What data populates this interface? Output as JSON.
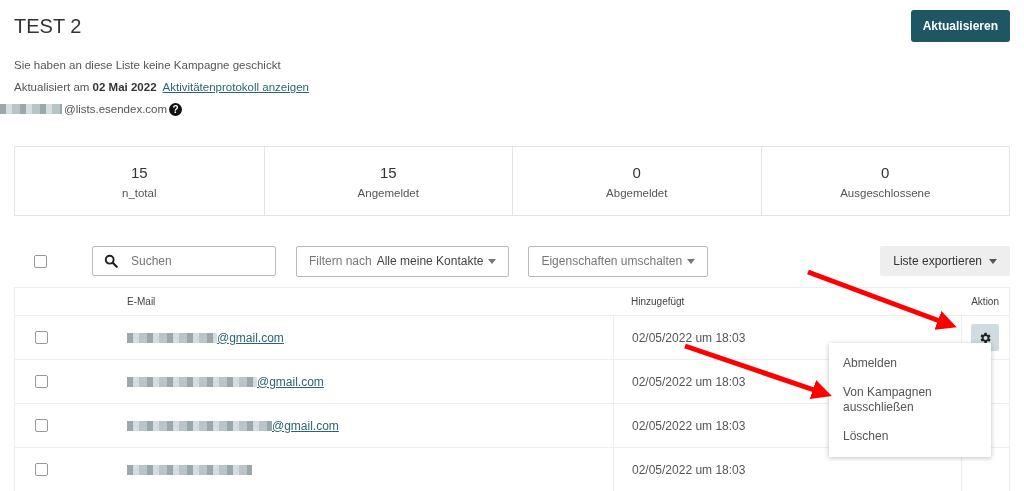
{
  "header": {
    "title": "TEST 2",
    "button": "Aktualisieren"
  },
  "info": {
    "campaign_note": "Sie haben an diese Liste keine Kampagne geschickt",
    "updated_prefix": "Aktualisiert am",
    "updated_date": "02 Mai 2022",
    "log_link": "Aktivitätenprotokoll anzeigen",
    "list_address": "@lists.esendex.com",
    "help_icon": "?"
  },
  "stats": [
    {
      "value": "15",
      "label": "n_total"
    },
    {
      "value": "15",
      "label": "Angemeldet"
    },
    {
      "value": "0",
      "label": "Abgemeldet"
    },
    {
      "value": "0",
      "label": "Ausgeschlossene"
    }
  ],
  "toolbar": {
    "select_all": {
      "checked": false
    },
    "search": {
      "placeholder": "Suchen"
    },
    "filter_prefix": "Filtern nach",
    "filter_value": "Alle meine Kontakte",
    "properties": "Eigenschaften umschalten",
    "export": "Liste exportieren"
  },
  "table": {
    "columns": [
      "E-Mail",
      "Hinzugefügt",
      "Aktion"
    ],
    "rows": [
      {
        "checked": false,
        "email": "@gmail.com",
        "added": "02/05/2022 um 18:03",
        "menu_open": true
      },
      {
        "checked": false,
        "email": "@gmail.com",
        "added": "02/05/2022 um 18:03",
        "menu_open": false
      },
      {
        "checked": false,
        "email": "@gmail.com",
        "added": "02/05/2022 um 18:03",
        "menu_open": false
      },
      {
        "checked": false,
        "added": "02/05/2022 um 18:03",
        "menu_open": false
      }
    ]
  },
  "action_menu": {
    "items": [
      "Abmelden",
      "Von Kampagnen ausschließen",
      "Löschen"
    ]
  }
}
